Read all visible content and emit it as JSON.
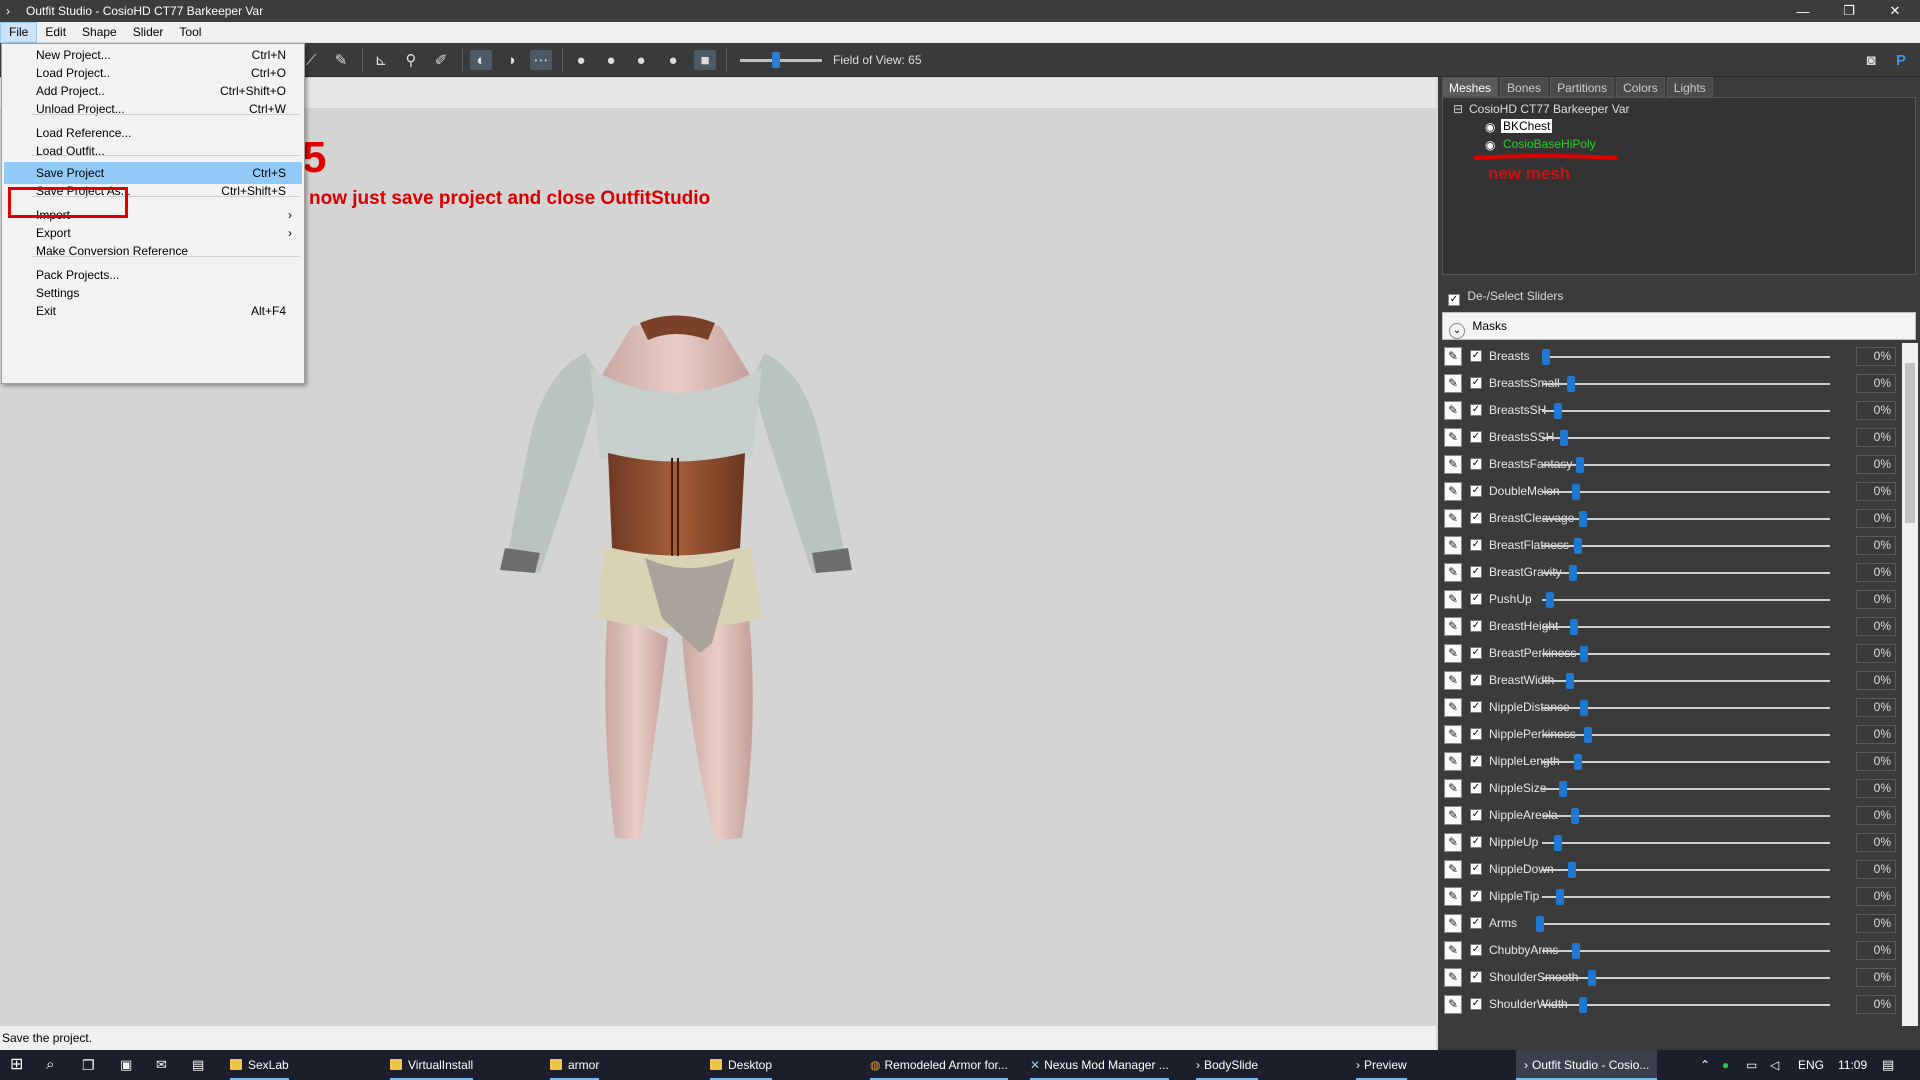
{
  "window": {
    "title": "Outfit Studio - CosioHD CT77 Barkeeper Var"
  },
  "menubar": [
    "File",
    "Edit",
    "Shape",
    "Slider",
    "Tool"
  ],
  "file_menu": [
    {
      "label": "New Project...",
      "shortcut": "Ctrl+N"
    },
    {
      "label": "Load Project..",
      "shortcut": "Ctrl+O"
    },
    {
      "label": "Add Project..",
      "shortcut": "Ctrl+Shift+O"
    },
    {
      "label": "Unload Project...",
      "shortcut": "Ctrl+W"
    },
    {
      "label": "Load Reference...",
      "shortcut": ""
    },
    {
      "label": "Load Outfit...",
      "shortcut": ""
    },
    {
      "label": "Save Project",
      "shortcut": "Ctrl+S"
    },
    {
      "label": "Save Project As...",
      "shortcut": "Ctrl+Shift+S"
    },
    {
      "label": "Import",
      "shortcut": ""
    },
    {
      "label": "Export",
      "shortcut": ""
    },
    {
      "label": "Make Conversion Reference",
      "shortcut": ""
    },
    {
      "label": "Pack Projects...",
      "shortcut": ""
    },
    {
      "label": "Settings",
      "shortcut": ""
    },
    {
      "label": "Exit",
      "shortcut": "Alt+F4"
    }
  ],
  "toolbar": {
    "fov_label": "Field of View: 65"
  },
  "annotations": {
    "step": "5",
    "instruction": "now just save project  and close OutfitStudio",
    "new_mesh": "new mesh"
  },
  "tabs": [
    "Meshes",
    "Bones",
    "Partitions",
    "Colors",
    "Lights"
  ],
  "meshes": {
    "project": "CosioHD CT77 Barkeeper Var",
    "items": [
      "BKChest",
      "CosioBaseHiPoly"
    ]
  },
  "slider_panel": {
    "deselect_label": "De-/Select Sliders",
    "masks_label": "Masks"
  },
  "sliders": [
    {
      "name": "Breasts",
      "value": "0%"
    },
    {
      "name": "BreastsSmall",
      "value": "0%"
    },
    {
      "name": "BreastsSH",
      "value": "0%"
    },
    {
      "name": "BreastsSSH",
      "value": "0%"
    },
    {
      "name": "BreastsFantasy",
      "value": "0%"
    },
    {
      "name": "DoubleMelon",
      "value": "0%"
    },
    {
      "name": "BreastCleavage",
      "value": "0%"
    },
    {
      "name": "BreastFlatness",
      "value": "0%"
    },
    {
      "name": "BreastGravity",
      "value": "0%"
    },
    {
      "name": "PushUp",
      "value": "0%"
    },
    {
      "name": "BreastHeight",
      "value": "0%"
    },
    {
      "name": "BreastPerkiness",
      "value": "0%"
    },
    {
      "name": "BreastWidth",
      "value": "0%"
    },
    {
      "name": "NippleDistance",
      "value": "0%"
    },
    {
      "name": "NipplePerkiness",
      "value": "0%"
    },
    {
      "name": "NippleLength",
      "value": "0%"
    },
    {
      "name": "NippleSize",
      "value": "0%"
    },
    {
      "name": "NippleAreola",
      "value": "0%"
    },
    {
      "name": "NippleUp",
      "value": "0%"
    },
    {
      "name": "NippleDown",
      "value": "0%"
    },
    {
      "name": "NippleTip",
      "value": "0%"
    },
    {
      "name": "Arms",
      "value": "0%"
    },
    {
      "name": "ChubbyArms",
      "value": "0%"
    },
    {
      "name": "ShoulderSmooth",
      "value": "0%"
    },
    {
      "name": "ShoulderWidth",
      "value": "0%"
    }
  ],
  "status": "Save the project.",
  "taskbar": {
    "items": [
      "SexLab",
      "VirtualInstall",
      "armor",
      "Desktop",
      "Remodeled Armor for...",
      "Nexus Mod Manager ...",
      "BodySlide",
      "Preview",
      "Outfit Studio - Cosio..."
    ],
    "lang": "ENG",
    "time": "11:09"
  }
}
